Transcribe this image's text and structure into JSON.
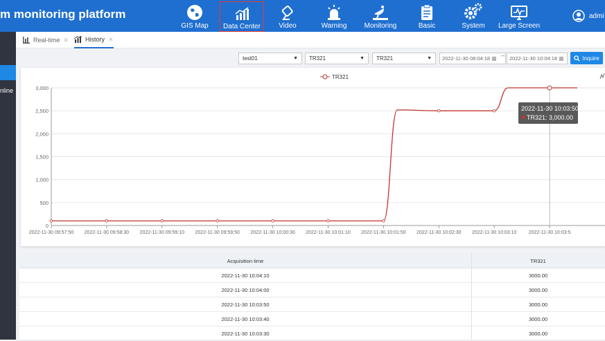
{
  "header": {
    "brand": "m monitoring platform",
    "user": "admi",
    "nav": [
      {
        "label": "GIS Map",
        "icon": "globe-icon",
        "active": false
      },
      {
        "label": "Data Center",
        "icon": "bar-chart-icon",
        "active": true
      },
      {
        "label": "Video",
        "icon": "camera-icon",
        "active": false
      },
      {
        "label": "Warning",
        "icon": "alarm-icon",
        "active": false
      },
      {
        "label": "Monitoring",
        "icon": "satellite-dish-icon",
        "active": false
      },
      {
        "label": "Basic",
        "icon": "clipboard-icon",
        "active": false
      },
      {
        "label": "System",
        "icon": "gears-icon",
        "active": false
      },
      {
        "label": "Large Screen",
        "icon": "monitor-icon",
        "active": false
      }
    ]
  },
  "sidebar": {
    "items": [
      {
        "label": "",
        "active": true
      },
      {
        "label": "nline",
        "active": false
      }
    ]
  },
  "tabs": [
    {
      "label": "Real-time",
      "icon": "bar-chart-icon",
      "active": false
    },
    {
      "label": "History",
      "icon": "line-chart-icon",
      "active": true
    }
  ],
  "filters": {
    "device": "test01",
    "sensor_a": "TR321",
    "sensor_b": "TR321",
    "start": "2022-11-30 08:04:18",
    "end": "2022-11-30 10:04:18",
    "dash": "--",
    "inquire": "Inquire"
  },
  "chart_data": {
    "type": "line",
    "legend": [
      "TR321"
    ],
    "series": [
      {
        "name": "TR321",
        "color": "#c23531",
        "x": [
          "2022-11-30 09:57:50",
          "2022-11-30 09:58:30",
          "2022-11-30 09:59:10",
          "2022-11-30 09:59:50",
          "2022-11-30 10:00:30",
          "2022-11-30 10:01:10",
          "2022-11-30 10:01:50",
          "2022-11-30 10:02:00",
          "2022-11-30 10:02:30",
          "2022-11-30 10:03:10",
          "2022-11-30 10:03:20",
          "2022-11-30 10:03:50",
          "2022-11-30 10:04:10"
        ],
        "values": [
          100,
          100,
          100,
          100,
          100,
          100,
          100,
          2520,
          2500,
          2500,
          3000,
          3000,
          3000
        ]
      }
    ],
    "x_ticks": [
      "2022-11-30 09:57:50",
      "2022-11-30 09:58:30",
      "2022-11-30 09:59:10",
      "2022-11-30 09:59:50",
      "2022-11-30 10:00:30",
      "2022-11-30 10:01:10",
      "2022-11-30 10:01:50",
      "2022-11-30 10:02:30",
      "2022-11-30 10:03:10",
      "2022-11-30 10:03:5"
    ],
    "y_ticks": [
      "0",
      "500",
      "1,000",
      "1,500",
      "2,000",
      "2,500",
      "3,000"
    ],
    "ylim": [
      0,
      3000
    ],
    "grid": true,
    "tooltip": {
      "time": "2022-11-30 10:03:50",
      "text": "TR321: 3,000.00"
    }
  },
  "table": {
    "headers": [
      "Acquisition time",
      "TR321"
    ],
    "rows": [
      [
        "2022-11-30 10:04:10",
        "3000.00"
      ],
      [
        "2022-11-30 10:04:00",
        "3000.00"
      ],
      [
        "2022-11-30 10:03:50",
        "3000.00"
      ],
      [
        "2022-11-30 10:03:40",
        "3000.00"
      ],
      [
        "2022-11-30 10:03:30",
        "3000.00"
      ]
    ]
  }
}
